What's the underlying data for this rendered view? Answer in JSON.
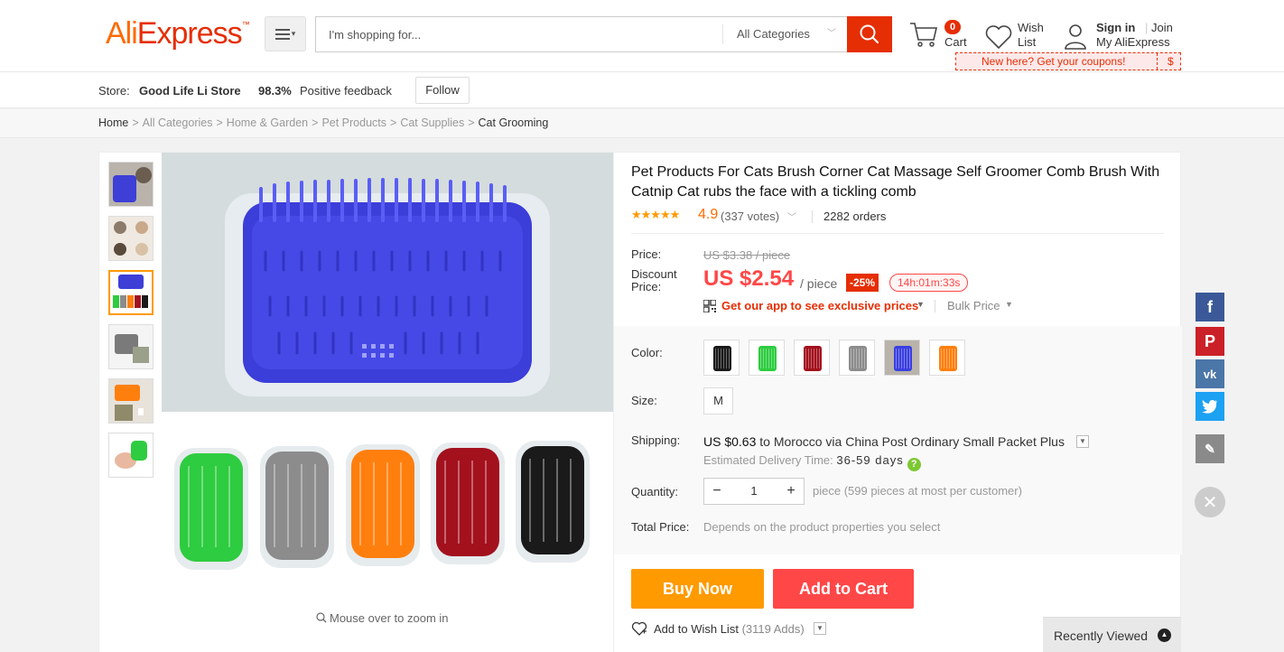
{
  "header": {
    "logo_text_ali": "Ali",
    "logo_text_express": "Express",
    "logo_tm": "™",
    "search_placeholder": "I'm shopping for...",
    "category_select": "All Categories",
    "cart_count": "0",
    "cart_label": "Cart",
    "wish_label_1": "Wish",
    "wish_label_2": "List",
    "sign_in": "Sign in",
    "join": "Join",
    "my_account": "My AliExpress",
    "coupon_text": "New here? Get your coupons!",
    "coupon_symbol": "$"
  },
  "store": {
    "label": "Store:",
    "name": "Good Life Li Store",
    "feedback_percent": "98.3%",
    "feedback_label": "Positive feedback",
    "follow_label": "Follow"
  },
  "breadcrumb": [
    "Home",
    "All Categories",
    "Home & Garden",
    "Pet Products",
    "Cat Supplies",
    "Cat Grooming"
  ],
  "gallery": {
    "zoom_hint": "Mouse over to zoom in",
    "thumbnails": [
      "thumb-cat-blue",
      "thumb-cats-collage",
      "thumb-colors-set",
      "thumb-gray-brush",
      "thumb-orange-catnip",
      "thumb-hand-green"
    ],
    "active_thumbnail": 2
  },
  "product": {
    "title": "Pet Products For Cats Brush Corner Cat Massage Self Groomer Comb Brush With Catnip Cat rubs the face with a tickling comb",
    "rating": "4.9",
    "votes": "(337 votes)",
    "orders": "2282 orders",
    "price_label": "Price:",
    "old_price": "US $3.38 / piece",
    "discount_label": "Discount Price:",
    "new_price": "US $2.54",
    "per_piece": "/ piece",
    "discount_badge": "-25%",
    "countdown": "14h:01m:33s",
    "app_promo": "Get our app to see exclusive prices",
    "bulk_price": "Bulk Price",
    "color_label": "Color:",
    "colors": [
      "#1a1a1a",
      "#2ecc40",
      "#a3111d",
      "#8c8c8c",
      "#3a3fe0",
      "#ff7f0e"
    ],
    "size_label": "Size:",
    "size_value": "M",
    "shipping_label": "Shipping:",
    "shipping_price": "US $0.63",
    "shipping_to": "to",
    "shipping_dest": "Morocco via China Post Ordinary Small Packet Plus",
    "delivery_label": "Estimated Delivery Time:",
    "delivery_days": "36-59 days",
    "quantity_label": "Quantity:",
    "quantity_value": "1",
    "quantity_note": "piece (599 pieces at most per customer)",
    "total_label": "Total Price:",
    "total_value": "Depends on the product properties you select",
    "buy_now": "Buy Now",
    "add_to_cart": "Add to Cart",
    "wishlist_label": "Add to Wish List",
    "wishlist_adds": "(3119 Adds)"
  },
  "sidebar_social": [
    "f",
    "P",
    "vk",
    "twitter",
    "edit"
  ],
  "recently_viewed": "Recently Viewed",
  "colors_accent": {
    "brand_red": "#e62e04",
    "orange": "#ff9a00",
    "price_red": "#ff4747"
  }
}
